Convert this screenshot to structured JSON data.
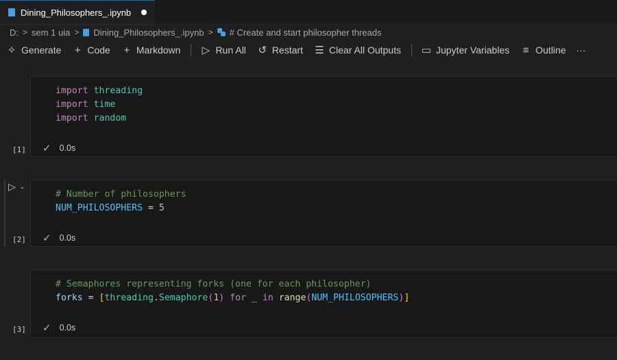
{
  "tab": {
    "filename": "Dining_Philosophers_.ipynb"
  },
  "breadcrumb": {
    "drive": "D:",
    "folder": "sem 1 uia",
    "file": "Dining_Philosophers_.ipynb",
    "section": "# Create and start philosopher threads"
  },
  "toolbar": {
    "generate": "Generate",
    "code": "Code",
    "markdown": "Markdown",
    "run_all": "Run All",
    "restart": "Restart",
    "clear_outputs": "Clear All Outputs",
    "jupyter_variables": "Jupyter Variables",
    "outline": "Outline",
    "more": "···"
  },
  "cells": [
    {
      "exec_count": "[1]",
      "status_time": "0.0s",
      "lines": [
        [
          {
            "t": "import",
            "c": "kw"
          },
          {
            "t": " ",
            "c": "op"
          },
          {
            "t": "threading",
            "c": "mod"
          }
        ],
        [
          {
            "t": "import",
            "c": "kw"
          },
          {
            "t": " ",
            "c": "op"
          },
          {
            "t": "time",
            "c": "mod"
          }
        ],
        [
          {
            "t": "import",
            "c": "kw"
          },
          {
            "t": " ",
            "c": "op"
          },
          {
            "t": "random",
            "c": "mod"
          }
        ]
      ]
    },
    {
      "exec_count": "[2]",
      "status_time": "0.0s",
      "lines": [
        [
          {
            "t": "# Number of philosophers",
            "c": "cm"
          }
        ],
        [
          {
            "t": "NUM_PHILOSOPHERS",
            "c": "cst"
          },
          {
            "t": " = ",
            "c": "op"
          },
          {
            "t": "5",
            "c": "num"
          }
        ]
      ]
    },
    {
      "exec_count": "[3]",
      "status_time": "0.0s",
      "lines": [
        [
          {
            "t": "# Semaphores representing forks (one for each philosopher)",
            "c": "cm"
          }
        ],
        [
          {
            "t": "forks",
            "c": "var"
          },
          {
            "t": " = ",
            "c": "op"
          },
          {
            "t": "[",
            "c": "br1"
          },
          {
            "t": "threading",
            "c": "mod"
          },
          {
            "t": ".",
            "c": "op"
          },
          {
            "t": "Semaphore",
            "c": "mod"
          },
          {
            "t": "(",
            "c": "br2"
          },
          {
            "t": "1",
            "c": "num"
          },
          {
            "t": ")",
            "c": "br2"
          },
          {
            "t": " ",
            "c": "op"
          },
          {
            "t": "for",
            "c": "kw"
          },
          {
            "t": " _ ",
            "c": "op"
          },
          {
            "t": "in",
            "c": "kw"
          },
          {
            "t": " ",
            "c": "op"
          },
          {
            "t": "range",
            "c": "fn"
          },
          {
            "t": "(",
            "c": "br2"
          },
          {
            "t": "NUM_PHILOSOPHERS",
            "c": "cst"
          },
          {
            "t": ")",
            "c": "br2"
          },
          {
            "t": "]",
            "c": "br1"
          }
        ]
      ]
    }
  ],
  "colors": {
    "accent": "#0078d4",
    "success": "#89d185"
  }
}
